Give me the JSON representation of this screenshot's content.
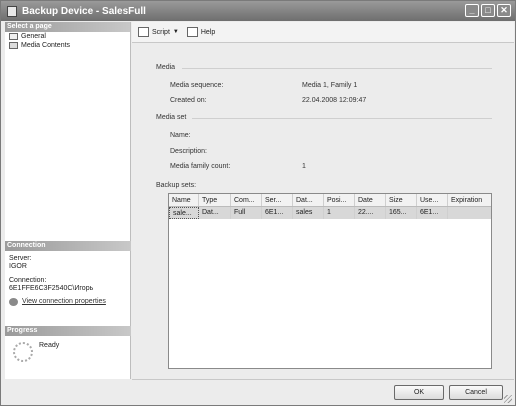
{
  "window": {
    "title": "Backup Device - SalesFull"
  },
  "titlebar": {
    "min": "_",
    "max": "□",
    "close": "✕"
  },
  "left": {
    "select_page_header": "Select a page",
    "pages": [
      {
        "label": "General"
      },
      {
        "label": "Media Contents"
      }
    ],
    "connection_header": "Connection",
    "server_label": "Server:",
    "server_value": "IGOR",
    "connection_label": "Connection:",
    "connection_value": "6E1FFE6C3F2540C\\Игорь",
    "view_props_link": "View connection properties",
    "progress_header": "Progress",
    "progress_status": "Ready"
  },
  "toolbar": {
    "script_label": "Script",
    "help_label": "Help"
  },
  "media": {
    "section_title": "Media",
    "sequence_label": "Media sequence:",
    "sequence_value": "Media 1, Family 1",
    "created_label": "Created on:",
    "created_value": "22.04.2008 12:09:47"
  },
  "media_set": {
    "section_title": "Media set",
    "name_label": "Name:",
    "description_label": "Description:",
    "family_count_label": "Media family count:",
    "family_count_value": "1"
  },
  "backup_sets": {
    "label": "Backup sets:",
    "columns": [
      "Name",
      "Type",
      "Com...",
      "Ser...",
      "Dat...",
      "Posi...",
      "Date",
      "Size",
      "Use...",
      "Expiration"
    ],
    "rows": [
      [
        "sale...",
        "Dat...",
        "Full",
        "6E1...",
        "sales",
        "1",
        "22....",
        "165...",
        "6E1...",
        ""
      ]
    ]
  },
  "buttons": {
    "ok": "OK",
    "cancel": "Cancel"
  }
}
